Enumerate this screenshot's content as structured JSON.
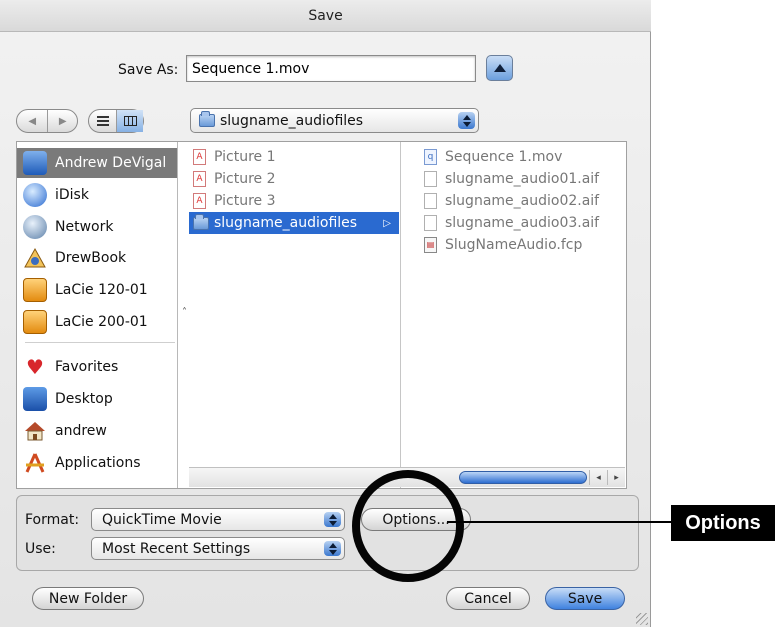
{
  "dialog": {
    "title": "Save"
  },
  "save_as": {
    "label": "Save As:",
    "value": "Sequence 1.mov"
  },
  "nav": {
    "back": "◀",
    "forward": "▶"
  },
  "location_popup": {
    "value": "slugname_audiofiles"
  },
  "sidebar": {
    "items": [
      {
        "label": "Andrew DeVigal",
        "icon": "computer-icon",
        "selected": true
      },
      {
        "label": "iDisk",
        "icon": "idisk-icon"
      },
      {
        "label": "Network",
        "icon": "network-globe-icon"
      },
      {
        "label": "DrewBook",
        "icon": "drewbook-icon"
      },
      {
        "label": "LaCie 120-01",
        "icon": "external-drive-icon"
      },
      {
        "label": "LaCie 200-01",
        "icon": "external-drive-icon"
      },
      {
        "label": "Favorites",
        "icon": "heart-icon"
      },
      {
        "label": "Desktop",
        "icon": "desktop-icon"
      },
      {
        "label": "andrew",
        "icon": "home-icon"
      },
      {
        "label": "Applications",
        "icon": "applications-icon"
      }
    ]
  },
  "column1": {
    "items": [
      {
        "label": "Picture 1",
        "icon": "pdf-file-icon"
      },
      {
        "label": "Picture 2",
        "icon": "pdf-file-icon"
      },
      {
        "label": "Picture 3",
        "icon": "pdf-file-icon"
      },
      {
        "label": "slugname_audiofiles",
        "icon": "folder-icon",
        "selected": true
      }
    ]
  },
  "column2": {
    "items": [
      {
        "label": "Sequence 1.mov",
        "icon": "quicktime-movie-icon"
      },
      {
        "label": "slugname_audio01.aif",
        "icon": "aiff-file-icon"
      },
      {
        "label": "slugname_audio02.aif",
        "icon": "aiff-file-icon"
      },
      {
        "label": "slugname_audio03.aif",
        "icon": "aiff-file-icon"
      },
      {
        "label": "SlugNameAudio.fcp",
        "icon": "fcp-project-icon"
      }
    ]
  },
  "export": {
    "format_label": "Format:",
    "format_value": "QuickTime Movie",
    "use_label": "Use:",
    "use_value": "Most Recent Settings",
    "options_button": "Options..."
  },
  "buttons": {
    "new_folder": "New Folder",
    "cancel": "Cancel",
    "save": "Save"
  },
  "annotation": {
    "callout": "Options"
  },
  "colors": {
    "selection": "#2a6ad0",
    "sidebar_selection": "#7a7a7a",
    "default_button": "#3f82df"
  }
}
